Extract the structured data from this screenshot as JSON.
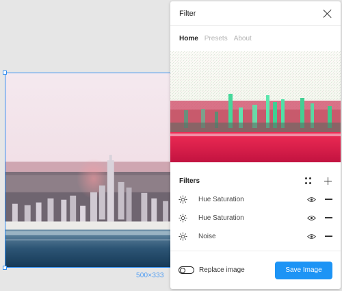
{
  "canvas": {
    "size_label": "500×333",
    "selection_color": "#2f8cf0"
  },
  "panel": {
    "title": "Filter",
    "tabs": [
      {
        "label": "Home",
        "active": true
      },
      {
        "label": "Presets",
        "active": false
      },
      {
        "label": "About",
        "active": false
      }
    ],
    "filters": {
      "title": "Filters",
      "items": [
        {
          "label": "Hue Saturation",
          "icon": "sun-icon",
          "visible": true
        },
        {
          "label": "Hue Saturation",
          "icon": "sun-icon",
          "visible": true
        },
        {
          "label": "Noise",
          "icon": "sun-icon",
          "visible": true
        }
      ]
    },
    "footer": {
      "replace_label": "Replace image",
      "replace_enabled": false,
      "save_label": "Save Image"
    }
  },
  "colors": {
    "accent": "#1d94f5",
    "preview_red": "#d81d4a",
    "preview_green": "#3fe0a0"
  }
}
